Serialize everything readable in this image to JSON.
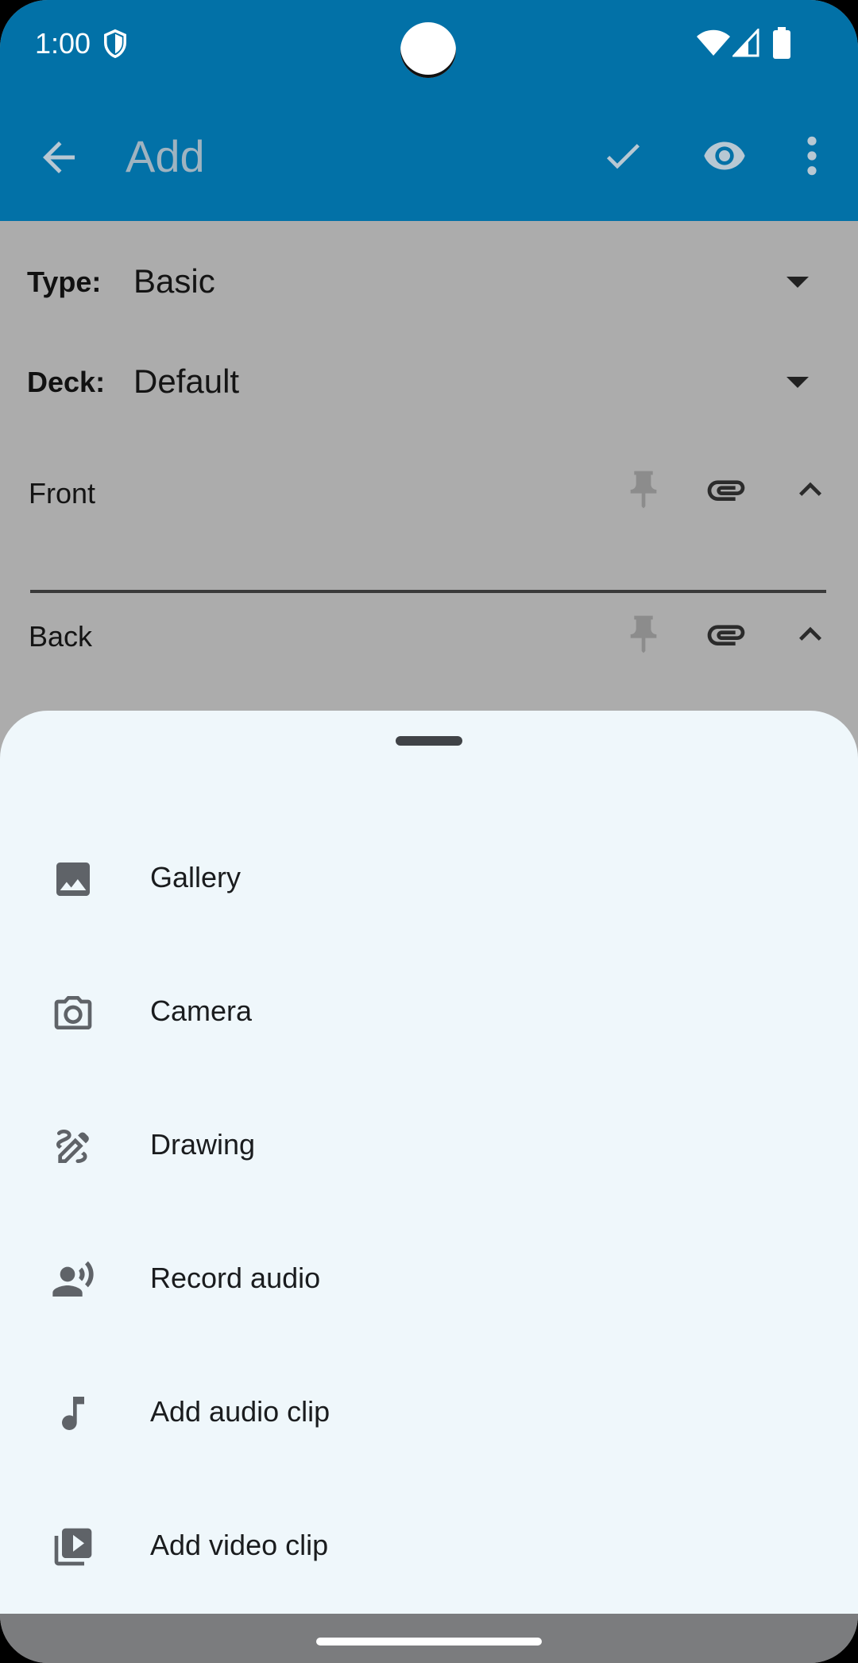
{
  "status_bar": {
    "time": "1:00",
    "icons": [
      "shield-icon",
      "wifi-icon",
      "signal-icon",
      "battery-icon"
    ]
  },
  "toolbar": {
    "title": "Add",
    "actions": [
      "back-arrow-icon",
      "check-icon",
      "eye-icon",
      "more-vert-icon"
    ]
  },
  "form": {
    "type_label": "Type:",
    "type_value": "Basic",
    "deck_label": "Deck:",
    "deck_value": "Default",
    "fields": [
      {
        "label": "Front"
      },
      {
        "label": "Back"
      }
    ]
  },
  "attach_sheet": {
    "options": [
      {
        "label": "Gallery",
        "icon": "image-icon"
      },
      {
        "label": "Camera",
        "icon": "camera-icon"
      },
      {
        "label": "Drawing",
        "icon": "draw-icon"
      },
      {
        "label": "Record audio",
        "icon": "record-voice-icon"
      },
      {
        "label": "Add audio clip",
        "icon": "music-note-icon"
      },
      {
        "label": "Add video clip",
        "icon": "video-library-icon"
      }
    ]
  },
  "colors": {
    "app_bar": "#0271a7",
    "scrim": "#acacac",
    "sheet_bg": "#eff7fb",
    "icon_gray": "#5f6368"
  }
}
